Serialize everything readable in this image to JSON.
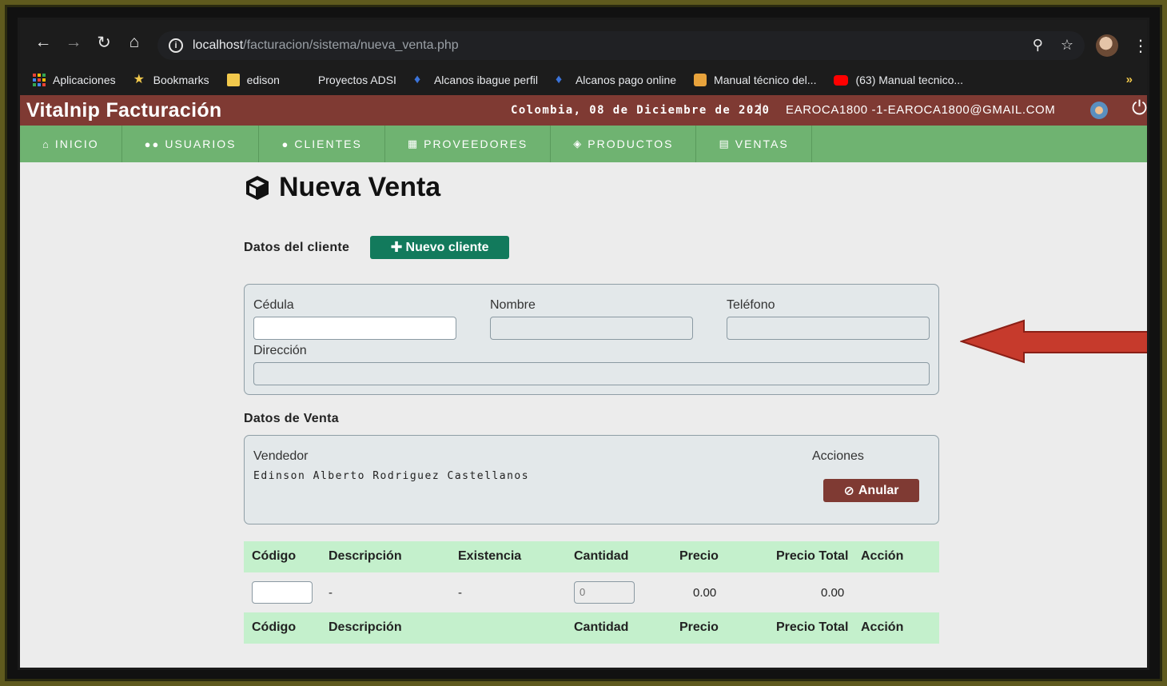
{
  "browser": {
    "url_host": "localhost",
    "url_path": "/facturacion/sistema/nueva_venta.php",
    "bookmarks": [
      {
        "label": "Aplicaciones",
        "icon": "apps-grid-icon",
        "color": "#f4b400"
      },
      {
        "label": "Bookmarks",
        "icon": "star-icon",
        "color": "#f2c94c"
      },
      {
        "label": "edison",
        "icon": "folder-icon",
        "color": "#f2c94c"
      },
      {
        "label": "Proyectos ADSI",
        "icon": "blank-icon",
        "color": "#1c1c1c"
      },
      {
        "label": "Alcanos ibague perfil",
        "icon": "flame-icon",
        "color": "#3b73d9"
      },
      {
        "label": "Alcanos pago online",
        "icon": "flame-icon",
        "color": "#3b73d9"
      },
      {
        "label": "Manual técnico del...",
        "icon": "doc-icon",
        "color": "#e8a33c"
      },
      {
        "label": "(63) Manual tecnico...",
        "icon": "youtube-icon",
        "color": "#ff0000"
      }
    ],
    "more_label": "»"
  },
  "app": {
    "title": "Vitalnip Facturación",
    "date": "Colombia, 08 de Diciembre de 2020",
    "separator": "|",
    "user": "EAROCA1800 -1-EAROCA1800@GMAIL.COM",
    "brand_color": "#7f3a33",
    "nav_color": "#6fb371"
  },
  "nav": [
    {
      "label": "INICIO",
      "icon": "home-icon"
    },
    {
      "label": "USUARIOS",
      "icon": "users-icon"
    },
    {
      "label": "CLIENTES",
      "icon": "user-icon"
    },
    {
      "label": "PROVEEDORES",
      "icon": "building-icon"
    },
    {
      "label": "PRODUCTOS",
      "icon": "cubes-icon"
    },
    {
      "label": "VENTAS",
      "icon": "file-icon"
    }
  ],
  "page": {
    "title": "Nueva Venta",
    "client_section": "Datos del cliente",
    "new_client_button": "Nuevo cliente",
    "client_fields": {
      "cedula": {
        "label": "Cédula",
        "value": ""
      },
      "nombre": {
        "label": "Nombre",
        "value": ""
      },
      "telefono": {
        "label": "Teléfono",
        "value": ""
      },
      "direccion": {
        "label": "Dirección",
        "value": ""
      }
    },
    "sale_section": "Datos de Venta",
    "vendedor_label": "Vendedor",
    "vendedor_name": "Edinson Alberto Rodriguez Castellanos",
    "acciones_label": "Acciones",
    "anular_button": "Anular"
  },
  "table": {
    "headers": [
      "Código",
      "Descripción",
      "Existencia",
      "Cantidad",
      "Precio",
      "Precio Total",
      "Acción"
    ],
    "entry_row": {
      "codigo": "",
      "descripcion": "-",
      "existencia": "-",
      "cantidad_placeholder": "0",
      "precio": "0.00",
      "precio_total": "0.00"
    },
    "footer_headers": [
      "Código",
      "Descripción",
      "Cantidad",
      "Precio",
      "Precio Total",
      "Acción"
    ]
  }
}
